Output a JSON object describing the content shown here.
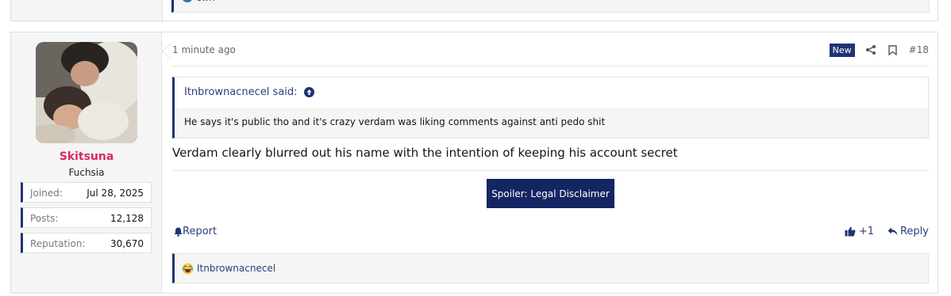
{
  "previous_post": {
    "reaction_user": "cwn"
  },
  "post": {
    "user": {
      "username": "Skitsuna",
      "user_title": "Fuchsia",
      "stats": [
        {
          "label": "Joined:",
          "value": "Jul 28, 2025"
        },
        {
          "label": "Posts:",
          "value": "12,128"
        },
        {
          "label": "Reputation:",
          "value": "30,670"
        }
      ]
    },
    "time": "1 minute ago",
    "new_badge": "New",
    "post_number": "#18",
    "quote": {
      "author_said": "Itnbrownacnecel said:",
      "body": "He says it's public tho and it's crazy verdam was liking comments against anti pedo shit"
    },
    "text": "Verdam clearly blurred out his name with the intention of keeping his account secret",
    "spoiler_label": "Spoiler: Legal Disclaimer",
    "report_label": "Report",
    "like_count": "+1",
    "reply_label": "Reply",
    "reactions": {
      "user": "Itnbrownacnecel"
    }
  },
  "colors": {
    "accent": "#1e3472",
    "username": "#d9276b",
    "link": "#2a3e7e",
    "panel": "#f5f5f5"
  },
  "icons": [
    "share-icon",
    "bookmark-icon",
    "arrow-up-circle-icon",
    "bell-icon",
    "thumbs-up-icon",
    "reply-icon",
    "laughing-emoji-icon"
  ]
}
